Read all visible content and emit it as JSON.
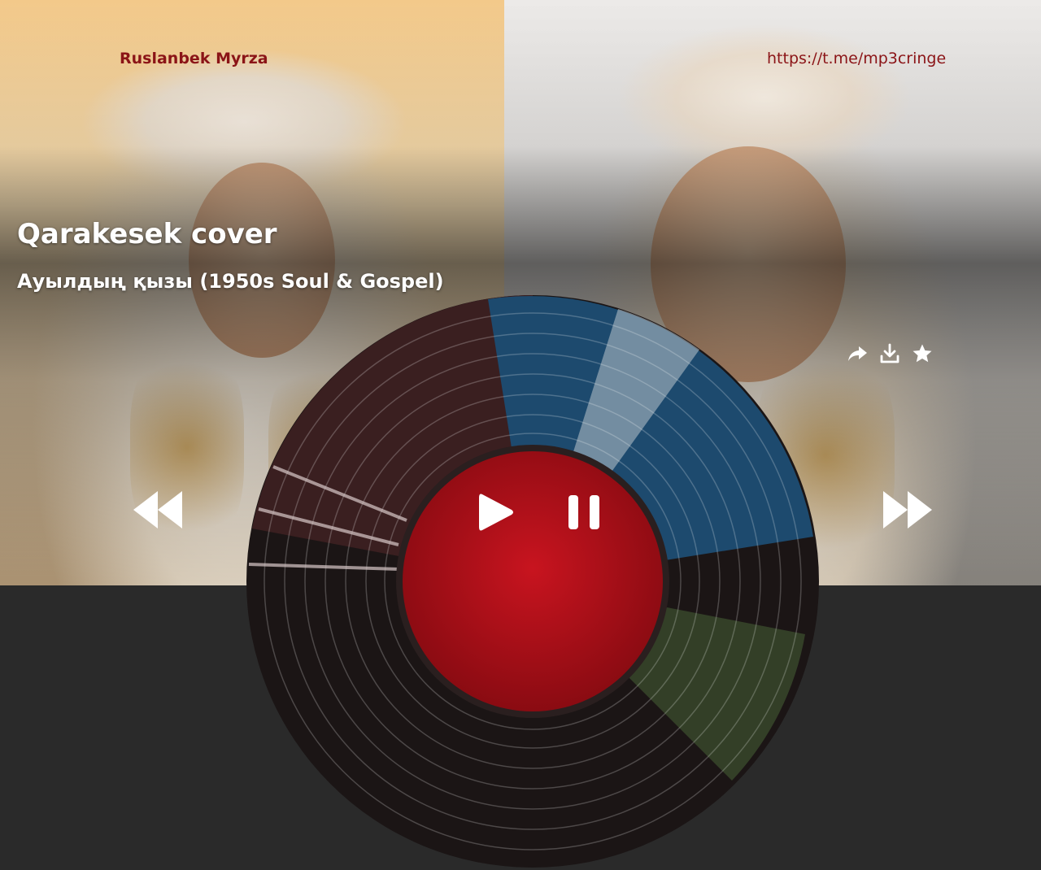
{
  "header": {
    "channel_name": "Ruslanbek Myrza",
    "channel_link": "https://t.me/mp3cringe"
  },
  "track": {
    "title": "Qarakesek cover",
    "subtitle": "Ауылдың қызы (1950s Soul & Gospel)"
  },
  "actions": [
    "share-icon",
    "download-icon",
    "star-icon"
  ],
  "controls": [
    "rewind-icon",
    "play-icon",
    "pause-icon",
    "fast-forward-icon"
  ],
  "colors": {
    "brand_text": "#8b1417",
    "disc_center": "#a8101a",
    "disc_blue": "#1d4a6e",
    "disc_dark": "#2a1c1c"
  }
}
